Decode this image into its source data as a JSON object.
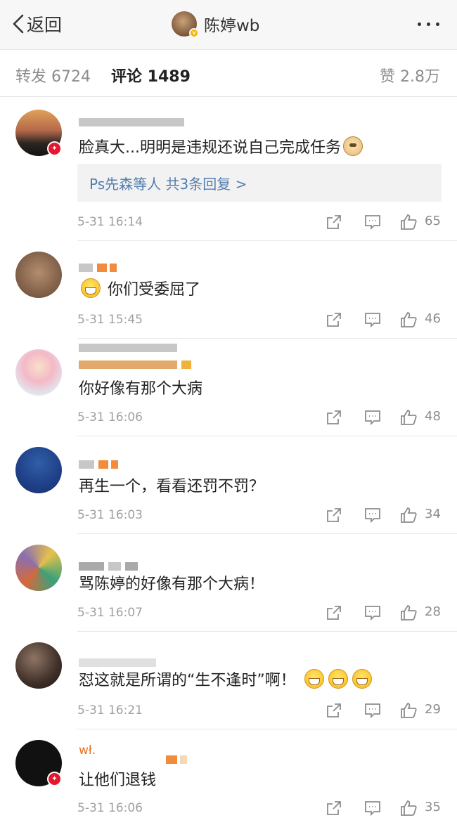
{
  "topbar": {
    "back_label": "返回",
    "title": "陈婷wb"
  },
  "tabs": {
    "repost": "转发 6724",
    "comment": "评论 1489",
    "like": "赞 2.8万"
  },
  "comments": [
    {
      "content": "脸真大...明明是违规还说自己完成任务",
      "emoji_after": [
        "doge"
      ],
      "reply": "Ps先森等人  共3条回复 >",
      "time": "5-31 16:14",
      "likes": "65"
    },
    {
      "content": "你们受委屈了",
      "emoji_before": [
        "grin"
      ],
      "time": "5-31 15:45",
      "likes": "46"
    },
    {
      "content": "你好像有那个大病",
      "time": "5-31 16:06",
      "likes": "48"
    },
    {
      "content": "再生一个，看看还罚不罚？",
      "time": "5-31 16:03",
      "likes": "34"
    },
    {
      "content": "骂陈婷的好像有那个大病！",
      "time": "5-31 16:07",
      "likes": "28"
    },
    {
      "content": "怼这就是所谓的“生不逢时”啊！",
      "emoji_after": [
        "grin",
        "grin",
        "grin"
      ],
      "time": "5-31 16:21",
      "likes": "29"
    },
    {
      "name": "wł.",
      "content": "让他们退钱",
      "time": "5-31 16:06",
      "likes": "35"
    }
  ],
  "colors": {
    "link": "#507daf",
    "badge": "#e6162d",
    "name_orange": "#e86f20"
  },
  "icons": [
    "chevron-left-icon",
    "more-icon",
    "share-icon",
    "comment-icon",
    "like-icon",
    "verified-badge-icon",
    "grin-emoji-icon",
    "doge-emoji-icon"
  ]
}
